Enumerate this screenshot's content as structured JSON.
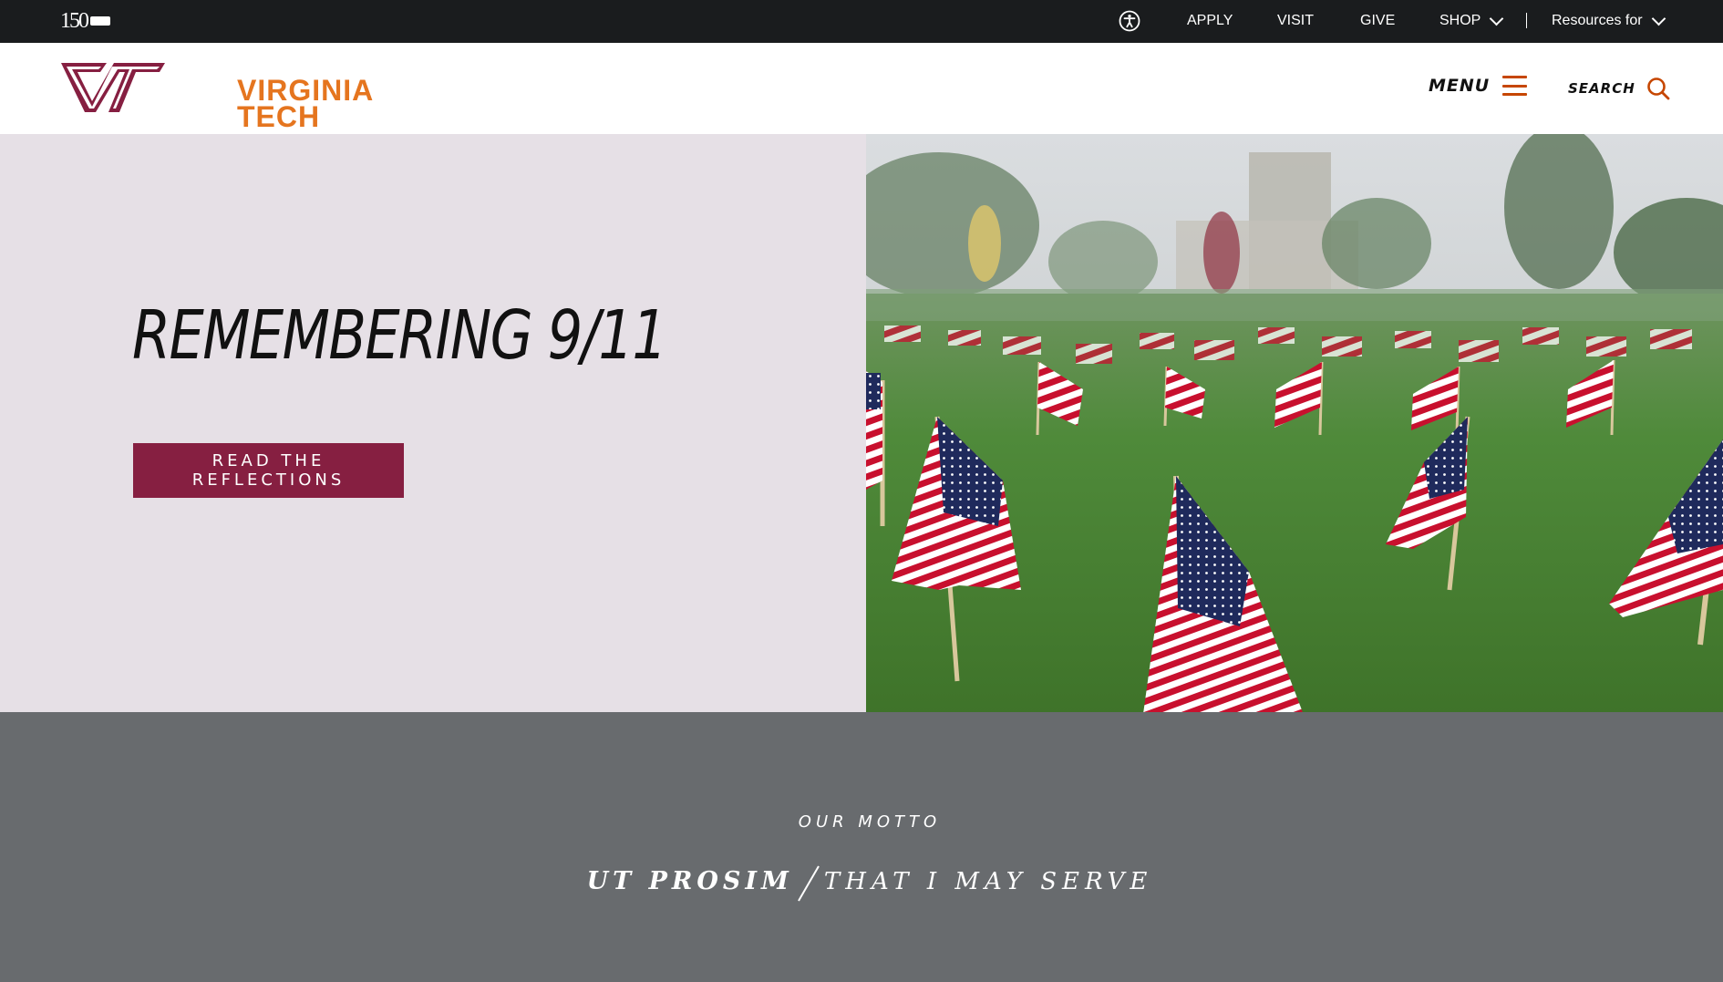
{
  "utility_bar": {
    "anniversary_logo": "150",
    "accessibility_icon": "accessibility-icon",
    "links": [
      {
        "label": "APPLY"
      },
      {
        "label": "VISIT"
      },
      {
        "label": "GIVE"
      },
      {
        "label": "SHOP"
      },
      {
        "label": "Resources for"
      }
    ]
  },
  "header": {
    "logo_line1": "VIRGINIA",
    "logo_line2": "TECH",
    "menu_label": "MENU",
    "search_label": "SEARCH"
  },
  "hero": {
    "title": "REMEMBERING 9/11",
    "cta_label": "READ THE REFLECTIONS",
    "photo": "american-flags-on-drillfield"
  },
  "motto": {
    "kicker": "OUR MOTTO",
    "latin": "UT PROSIM",
    "english": "THAT I MAY SERVE"
  },
  "colors": {
    "maroon": "#861f41",
    "orange": "#e5751f",
    "hero_bg": "#e6e0e6",
    "motto_bg": "#686b6e",
    "utility_bg": "#1a1c1e"
  }
}
